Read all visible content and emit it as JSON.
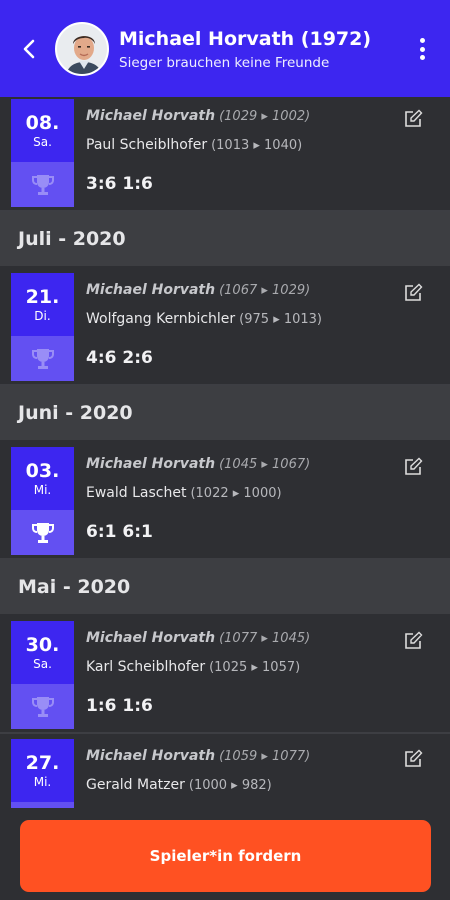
{
  "header": {
    "title": "Michael Horvath (1972)",
    "subtitle": "Sieger brauchen keine Freunde",
    "back_icon": "arrow-back-icon",
    "menu_icon": "more-vertical-icon",
    "accent_color": "#3d26f0"
  },
  "matches": [
    {
      "day": "08.",
      "weekday": "Sa.",
      "player1": "Michael Horvath",
      "player1_rating": "(1029 ▸ 1002)",
      "player2": "Paul Scheiblhofer",
      "player2_rating": "(1013 ▸ 1040)",
      "score": "3:6 1:6",
      "won": false
    }
  ],
  "months": [
    {
      "label": "Juli - 2020",
      "matches": [
        {
          "day": "21.",
          "weekday": "Di.",
          "player1": "Michael Horvath",
          "player1_rating": "(1067 ▸ 1029)",
          "player2": "Wolfgang Kernbichler",
          "player2_rating": "(975 ▸ 1013)",
          "score": "4:6 2:6",
          "won": false
        }
      ]
    },
    {
      "label": "Juni - 2020",
      "matches": [
        {
          "day": "03.",
          "weekday": "Mi.",
          "player1": "Michael Horvath",
          "player1_rating": "(1045 ▸ 1067)",
          "player2": "Ewald Laschet",
          "player2_rating": "(1022 ▸ 1000)",
          "score": "6:1 6:1",
          "won": true
        }
      ]
    },
    {
      "label": "Mai - 2020",
      "matches": [
        {
          "day": "30.",
          "weekday": "Sa.",
          "player1": "Michael Horvath",
          "player1_rating": "(1077 ▸ 1045)",
          "player2": "Karl Scheiblhofer",
          "player2_rating": "(1025 ▸ 1057)",
          "score": "1:6 1:6",
          "won": false
        },
        {
          "day": "27.",
          "weekday": "Mi.",
          "player1": "Michael Horvath",
          "player1_rating": "(1059 ▸ 1077)",
          "player2": "Gerald Matzer",
          "player2_rating": "(1000 ▸ 982)",
          "score": "",
          "won": false
        }
      ]
    }
  ],
  "cta": {
    "label": "Spieler*in fordern",
    "color": "#ff5122"
  }
}
